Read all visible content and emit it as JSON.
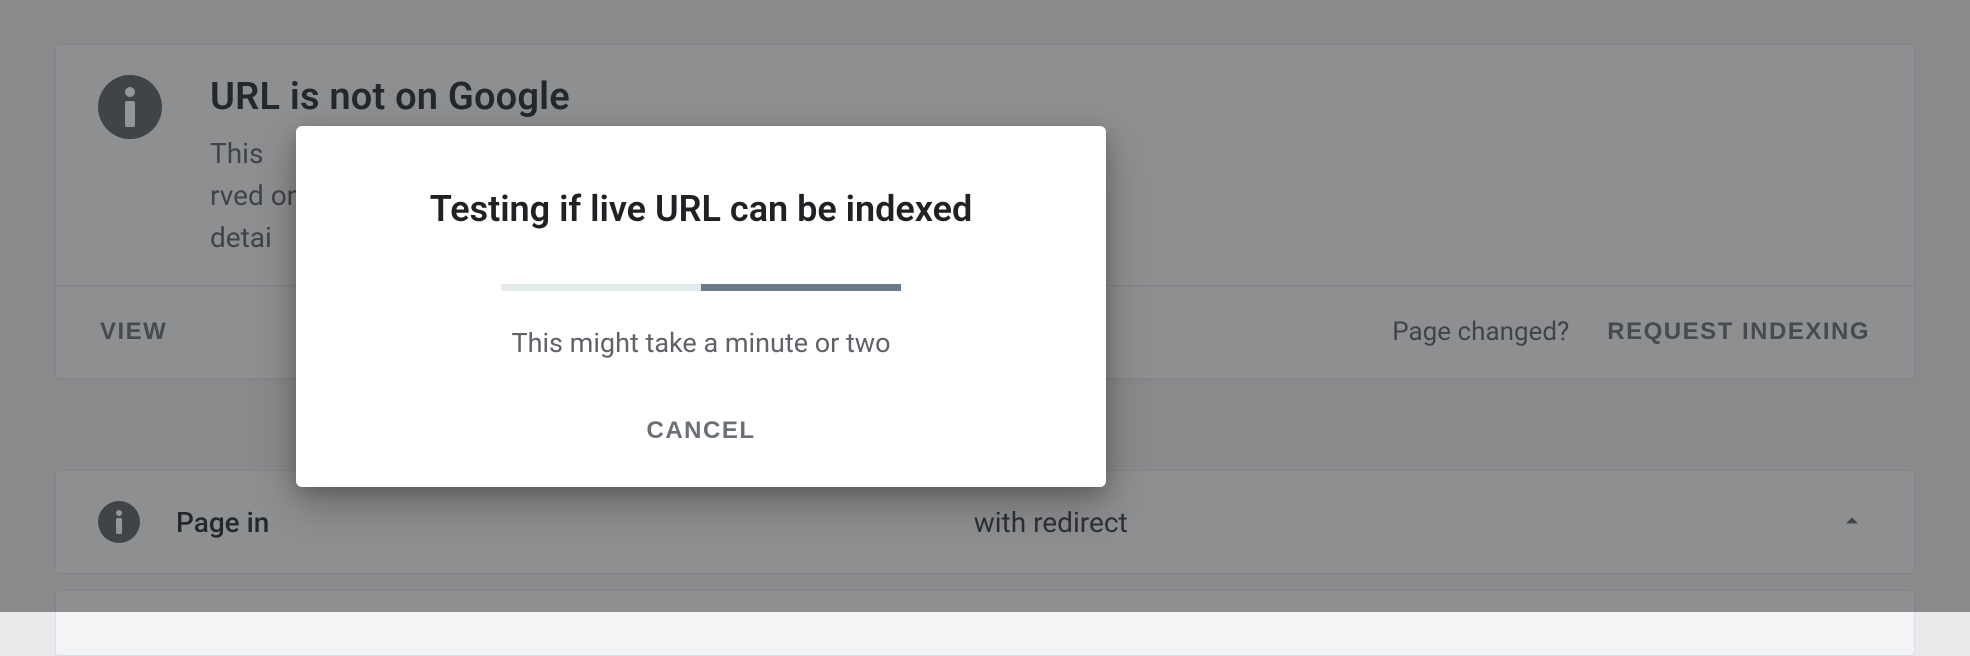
{
  "card": {
    "title": "URL is not on Google",
    "subtitle_prefix": "This",
    "subtitle_mid": "rved on Google. See the",
    "subtitle_line2_prefix": "detai",
    "view_button": "VIEW",
    "page_changed_hint": "Page changed?",
    "request_indexing_button": "REQUEST INDEXING"
  },
  "row": {
    "title_prefix": "Page in",
    "value_suffix": "with redirect"
  },
  "dialog": {
    "title": "Testing if live URL can be indexed",
    "subtitle": "This might take a minute or two",
    "cancel": "CANCEL"
  }
}
